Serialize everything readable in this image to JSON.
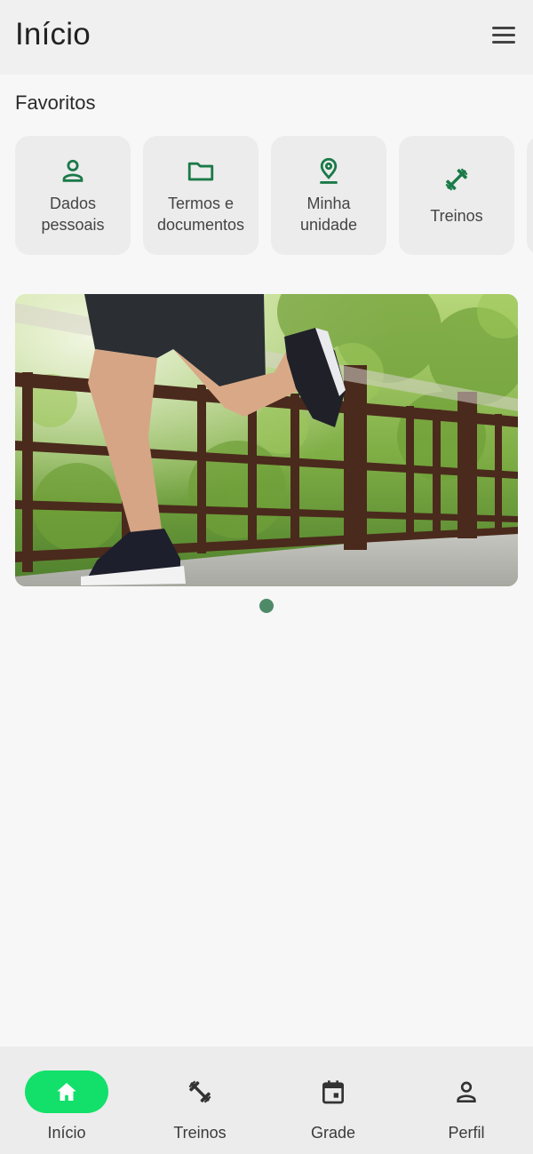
{
  "header": {
    "title": "Início",
    "menu_icon": "hamburger-menu-icon"
  },
  "favorites": {
    "title": "Favoritos",
    "items": [
      {
        "label": "Dados\npessoais",
        "icon": "person-icon"
      },
      {
        "label": "Termos e\ndocumentos",
        "icon": "folder-icon"
      },
      {
        "label": "Minha\nunidade",
        "icon": "location-pin-icon"
      },
      {
        "label": "Treinos",
        "icon": "dumbbell-icon"
      }
    ]
  },
  "banner": {
    "image": "runner-on-bridge-photo",
    "page_count": 1,
    "active_page": 1
  },
  "bottom_nav": {
    "items": [
      {
        "label": "Início",
        "icon": "home-icon",
        "active": true
      },
      {
        "label": "Treinos",
        "icon": "dumbbell-icon",
        "active": false
      },
      {
        "label": "Grade",
        "icon": "calendar-icon",
        "active": false
      },
      {
        "label": "Perfil",
        "icon": "person-icon",
        "active": false
      }
    ]
  },
  "colors": {
    "accent_green": "#1a7a48",
    "active_pill": "#12e06a",
    "carousel_dot": "#4f8a68"
  }
}
